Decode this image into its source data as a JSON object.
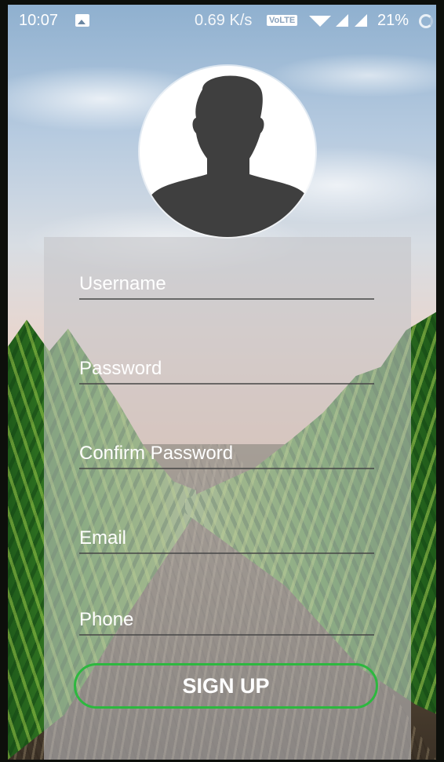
{
  "status_bar": {
    "time": "10:07",
    "network_speed": "0.69 K/s",
    "volte_label": "VoLTE",
    "battery_percent": "21%",
    "icons": [
      "image-icon",
      "volte-icon",
      "wifi-icon",
      "signal-icon",
      "signal-icon",
      "battery-icon"
    ]
  },
  "form": {
    "fields": [
      {
        "placeholder": "Username",
        "value": ""
      },
      {
        "placeholder": "Password",
        "value": ""
      },
      {
        "placeholder": "Confirm Password",
        "value": ""
      },
      {
        "placeholder": "Email",
        "value": ""
      },
      {
        "placeholder": "Phone",
        "value": ""
      }
    ],
    "signup_label": "SIGN UP"
  },
  "colors": {
    "accent": "#2db83f",
    "panel": "#c4c4c8",
    "avatar_silhouette": "#3f3f3f",
    "text": "#ffffff"
  }
}
